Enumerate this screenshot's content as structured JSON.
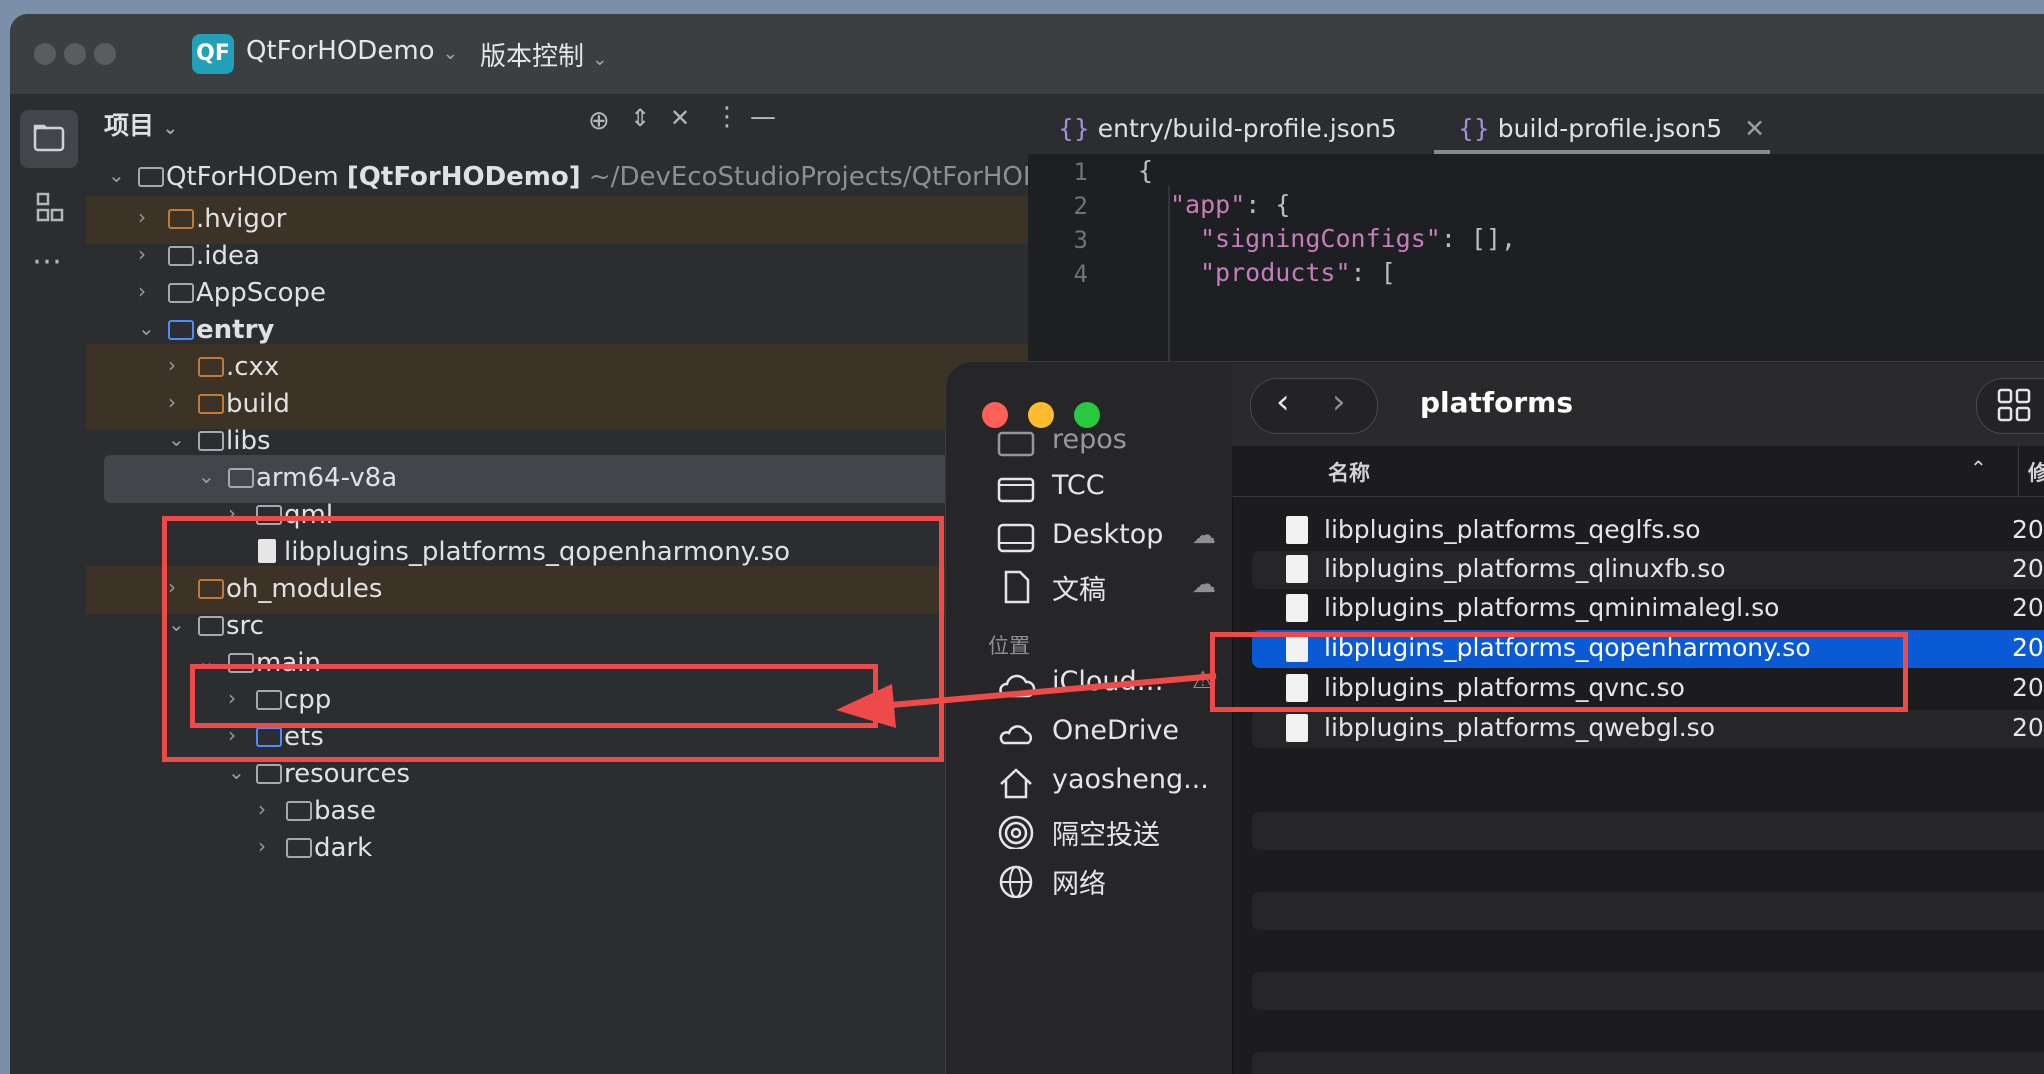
{
  "ide": {
    "app_badge": "QF",
    "project_name": "QtForHODemo",
    "vcs_menu": "版本控制",
    "panel_title": "项目",
    "tree": {
      "root_name": "QtForHODem",
      "root_module": "[QtForHODemo]",
      "root_path": "~/DevEcoStudioProjects/QtForHODem",
      "items": [
        {
          "label": ".hvigor"
        },
        {
          "label": ".idea"
        },
        {
          "label": "AppScope"
        },
        {
          "label": "entry"
        },
        {
          "label": ".cxx"
        },
        {
          "label": "build"
        },
        {
          "label": "libs"
        },
        {
          "label": "arm64-v8a"
        },
        {
          "label": "qml"
        },
        {
          "label": "libplugins_platforms_qopenharmony.so"
        },
        {
          "label": "oh_modules"
        },
        {
          "label": "src"
        },
        {
          "label": "main"
        },
        {
          "label": "cpp"
        },
        {
          "label": "ets"
        },
        {
          "label": "resources"
        },
        {
          "label": "base"
        },
        {
          "label": "dark"
        }
      ]
    },
    "editor": {
      "tabs": [
        {
          "label": "entry/build-profile.json5"
        },
        {
          "label": "build-profile.json5"
        }
      ],
      "lines": [
        {
          "num": "1",
          "text": "{"
        },
        {
          "num": "2",
          "key": "\"app\"",
          "rest": ": {"
        },
        {
          "num": "3",
          "key": "\"signingConfigs\"",
          "rest": ": [],"
        },
        {
          "num": "4",
          "key": "\"products\"",
          "rest": ": ["
        }
      ]
    }
  },
  "finder": {
    "title": "platforms",
    "column_name": "名称",
    "column_modified": "修",
    "sidebar": {
      "repos": "repos",
      "tcc": "TCC",
      "desktop": "Desktop",
      "documents": "文稿",
      "locations_header": "位置",
      "icloud": "iCloud…",
      "onedrive": "OneDrive",
      "home": "yaosheng...",
      "airdrop": "隔空投送",
      "network": "网络"
    },
    "files": [
      {
        "name": "libplugins_platforms_qeglfs.so",
        "date": "20"
      },
      {
        "name": "libplugins_platforms_qlinuxfb.so",
        "date": "20"
      },
      {
        "name": "libplugins_platforms_qminimalegl.so",
        "date": "20"
      },
      {
        "name": "libplugins_platforms_qopenharmony.so",
        "date": "20",
        "selected": true
      },
      {
        "name": "libplugins_platforms_qvnc.so",
        "date": "20"
      },
      {
        "name": "libplugins_platforms_qwebgl.so",
        "date": "20"
      }
    ]
  },
  "colors": {
    "annotation": "#ee4a4a",
    "selection": "#0a5ad6",
    "ide_bg": "#2b2d30",
    "editor_bg": "#1e1f22"
  }
}
